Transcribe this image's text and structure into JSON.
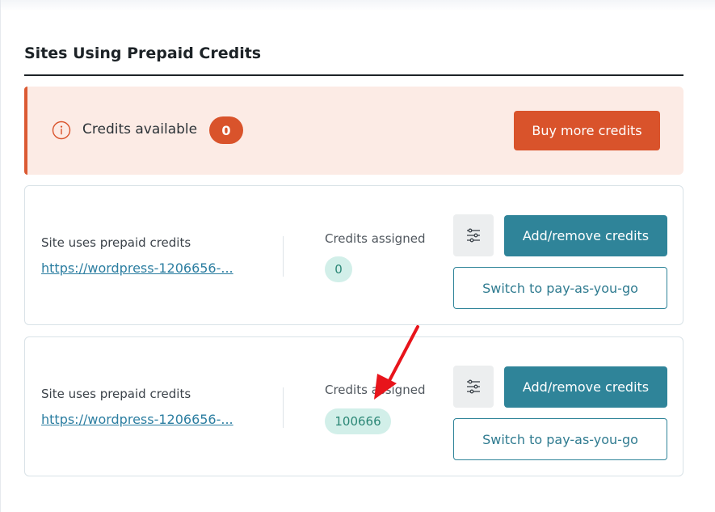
{
  "section": {
    "title": "Sites Using Prepaid Credits"
  },
  "banner": {
    "credits_label": "Credits available",
    "credits_count": "0",
    "buy_button": "Buy more credits",
    "icon": "info-circle-icon",
    "accent_color": "#d9532b"
  },
  "sites": [
    {
      "label": "Site uses prepaid credits",
      "url": "https://wordpress-1206656-...",
      "assigned_label": "Credits assigned",
      "assigned_value": "0",
      "settings_icon": "sliders-icon",
      "add_remove_button": "Add/remove credits",
      "switch_button": "Switch to pay-as-you-go"
    },
    {
      "label": "Site uses prepaid credits",
      "url": "https://wordpress-1206656-...",
      "assigned_label": "Credits assigned",
      "assigned_value": "100666",
      "settings_icon": "sliders-icon",
      "add_remove_button": "Add/remove credits",
      "switch_button": "Switch to pay-as-you-go"
    }
  ],
  "annotation": {
    "icon": "red-arrow-icon",
    "color": "#e8141b"
  }
}
